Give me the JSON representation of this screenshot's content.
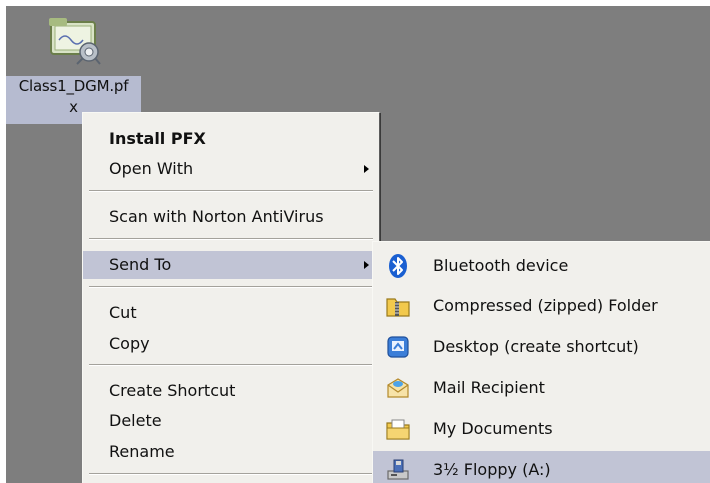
{
  "desktop": {
    "file": {
      "name_line1": "Class1_DGM.pf",
      "name_line2": "x",
      "icon": "certificate-file-icon"
    }
  },
  "context_menu": {
    "items": [
      {
        "label": "Install PFX",
        "bold": true
      },
      {
        "label": "Open With",
        "submenu": true
      },
      {
        "label": "Scan with Norton AntiVirus"
      },
      {
        "label": "Send To",
        "submenu": true,
        "highlighted": true
      },
      {
        "label": "Cut"
      },
      {
        "label": "Copy"
      },
      {
        "label": "Create Shortcut"
      },
      {
        "label": "Delete"
      },
      {
        "label": "Rename"
      }
    ]
  },
  "sendto_menu": {
    "items": [
      {
        "label": "Bluetooth device",
        "icon": "bluetooth-icon"
      },
      {
        "label": "Compressed (zipped) Folder",
        "icon": "zip-folder-icon"
      },
      {
        "label": "Desktop (create shortcut)",
        "icon": "desktop-shortcut-icon"
      },
      {
        "label": "Mail Recipient",
        "icon": "mail-envelope-icon"
      },
      {
        "label": "My Documents",
        "icon": "my-documents-icon"
      },
      {
        "label": "3½ Floppy (A:)",
        "icon": "floppy-drive-icon",
        "highlighted": true
      }
    ]
  },
  "colors": {
    "desktop": "#7e7e7e",
    "menu_bg": "#f1f0ec",
    "highlight": "#c1c4d5",
    "bluetooth": "#1a5fd1"
  }
}
